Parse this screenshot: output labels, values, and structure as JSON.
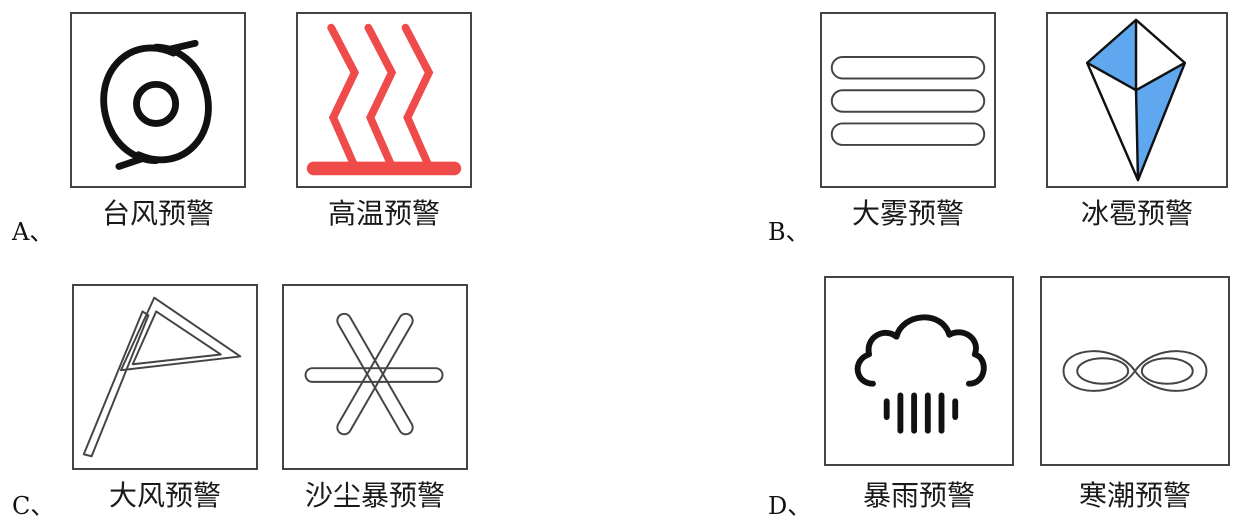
{
  "options": [
    {
      "label": "A、",
      "signs": [
        {
          "icon": "typhoon-icon",
          "caption": "台风预警"
        },
        {
          "icon": "heat-wave-icon",
          "caption": "高温预警"
        }
      ]
    },
    {
      "label": "B、",
      "signs": [
        {
          "icon": "fog-icon",
          "caption": "大雾预警"
        },
        {
          "icon": "hail-icon",
          "caption": "冰雹预警"
        }
      ]
    },
    {
      "label": "C、",
      "signs": [
        {
          "icon": "wind-flag-icon",
          "caption": "大风预警"
        },
        {
          "icon": "sandstorm-icon",
          "caption": "沙尘暴预警"
        }
      ]
    },
    {
      "label": "D、",
      "signs": [
        {
          "icon": "rainstorm-icon",
          "caption": "暴雨预警"
        },
        {
          "icon": "cold-wave-icon",
          "caption": "寒潮预警"
        }
      ]
    }
  ],
  "colors": {
    "heat_red": "#ef4b4b",
    "hail_blue": "#5fa8f0",
    "stroke": "#111111"
  }
}
